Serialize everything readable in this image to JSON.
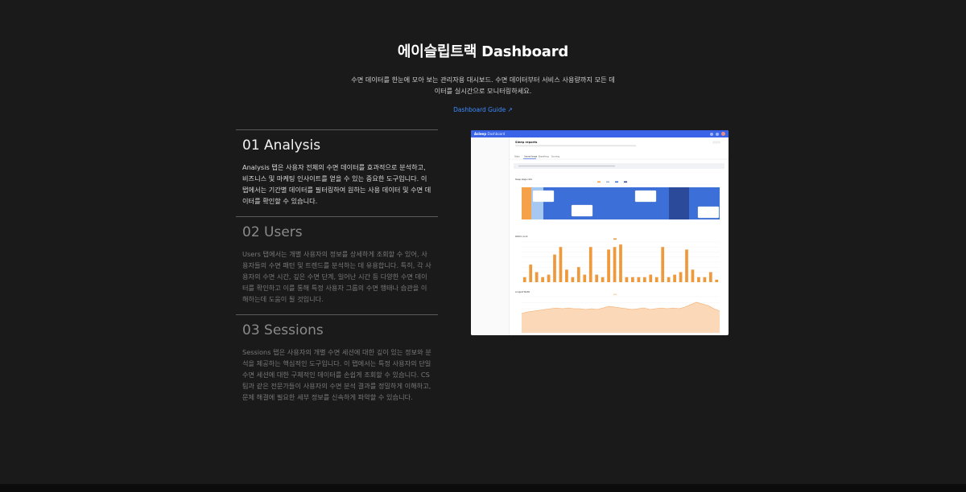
{
  "hero": {
    "title": "에이슬립트랙 Dashboard",
    "description": "수면 데이터를 한눈에 모아 보는 관리자용 대시보드. 수면 데이터부터 서비스 사용량까지 모든 데이터를 실시간으로 모니터링하세요.",
    "guide_link": "Dashboard Guide ↗"
  },
  "sections": [
    {
      "title": "01 Analysis",
      "body": "Analysis 탭은 사용자 전체의 수면 데이터를 효과적으로 분석하고, 비즈니스 및 마케팅 인사이트를 얻을 수 있는 중요한 도구입니다. 이 탭에서는 기간별 데이터를 필터링하여 원하는 사용 데이터 및 수면 데이터를 확인할 수 있습니다."
    },
    {
      "title": "02 Users",
      "body": "Users 탭에서는 개별 사용자의 정보를 상세하게 조회할 수 있어, 사용자들의 수면 패턴 및 트렌드를 분석하는 데 유용합니다. 특히, 각 사용자의 수면 시간, 깊은 수면 단계, 일어난 시간 등 다양한 수면 데이터를 확인하고 이를 통해 특정 사용자 그룹의 수면 행태나 습관을 이해하는데 도움이 될 것입니다."
    },
    {
      "title": "03 Sessions",
      "body": "Sessions 탭은 사용자의 개별 수면 세션에 대한 깊이 있는 정보와 분석을 제공하는 핵심적인 도구입니다. 이 탭에서는 특정 사용자의 단일 수면 세션에 대한 구체적인 데이터를 손쉽게 조회할 수 있습니다. CS 팀과 같은 전문가들이 사용자의 수면 분석 결과를 정밀하게 이해하고, 문제 해결에 필요한 세부 정보를 신속하게 파악할 수 있습니다."
    }
  ],
  "preview": {
    "logo": "Asleep",
    "logo_suffix": "Dashboard",
    "page_title": "Sleep reports",
    "tabs": [
      "Stats",
      "Users/Usage",
      "Breathing",
      "Snoring"
    ],
    "chart_titles": [
      "Sleep stage ratio",
      "WASO count",
      "Longest WASO"
    ],
    "colors": {
      "topbar": "#3a64e8",
      "awake": "#f4a14a",
      "light": "#a7c8f0",
      "deep": "#3c6fd8",
      "rem": "#2b4a9a",
      "waso_bar": "#ee9a3c",
      "area_fill": "#fbd9b8",
      "area_line": "#f2a866"
    }
  },
  "chart_data": [
    {
      "type": "bar",
      "title": "WASO count",
      "values": [
        2,
        7,
        4,
        2,
        3,
        11,
        14,
        5,
        2,
        6,
        3,
        14,
        3,
        2,
        13,
        14,
        15,
        2,
        2,
        2,
        2,
        3,
        2,
        14,
        2,
        3,
        4,
        13,
        5,
        2,
        2,
        4,
        1
      ]
    },
    {
      "type": "area",
      "title": "Longest WASO",
      "values": [
        24,
        26,
        27,
        28,
        29,
        30,
        31,
        30,
        31,
        30,
        30,
        29,
        30,
        29,
        31,
        33,
        32,
        31,
        30,
        29,
        30,
        31,
        29,
        30,
        31,
        30,
        31,
        30,
        32,
        35,
        38,
        36,
        34,
        30,
        27
      ]
    }
  ]
}
